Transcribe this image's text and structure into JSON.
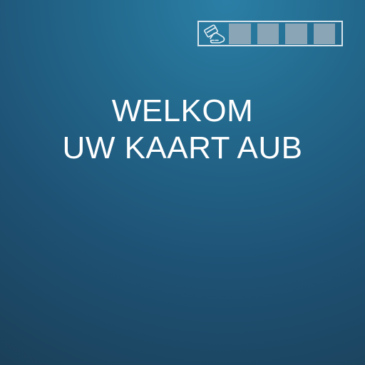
{
  "status": {
    "icon": "card-insert-icon",
    "slots": 4,
    "slot_color": "#8aa5b6"
  },
  "prompt": {
    "line1": "WELKOM",
    "line2": "UW KAART AUB"
  },
  "colors": {
    "background_top": "#2b7fa6",
    "background_bottom": "#1b4059",
    "text": "#ffffff"
  }
}
